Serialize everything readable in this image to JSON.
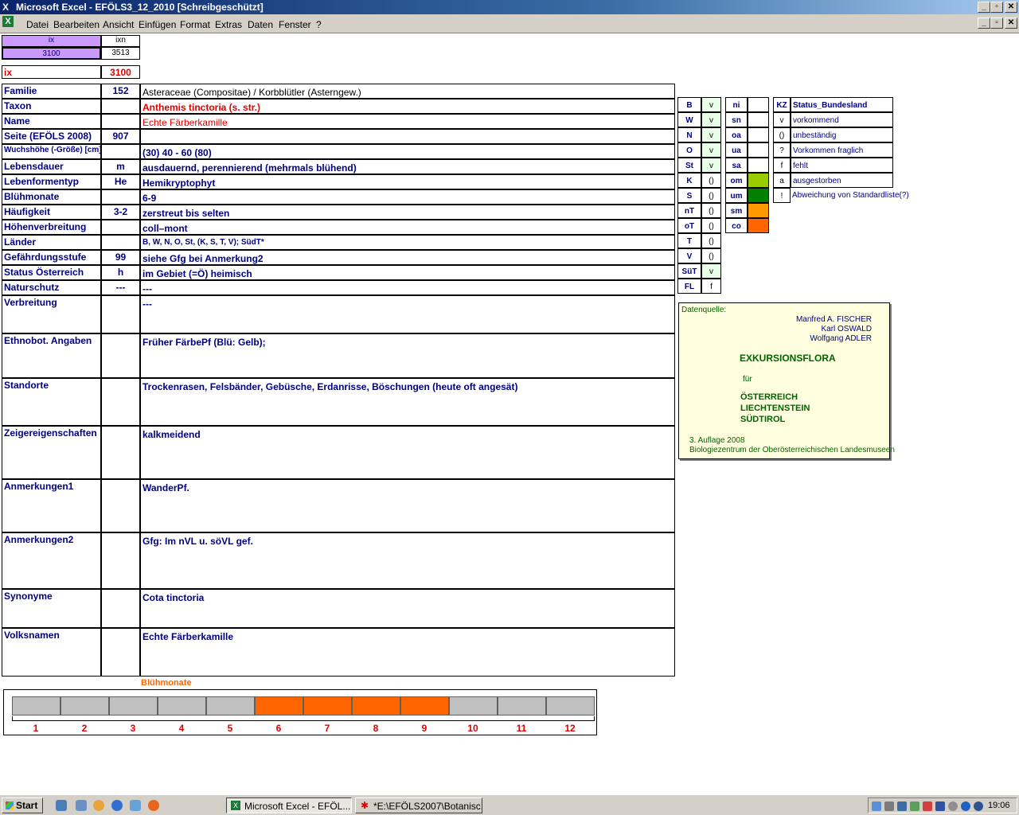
{
  "window": {
    "title": "Microsoft Excel - EFÖLS3_12_2010  [Schreibgeschützt]"
  },
  "menu": [
    "Datei",
    "Bearbeiten",
    "Ansicht",
    "Einfügen",
    "Format",
    "Extras",
    "Daten",
    "Fenster",
    "?"
  ],
  "header": {
    "ix_label": "ix",
    "ixn_label": "ixn",
    "ix_value": "3100",
    "ixn_value": "3513",
    "ix2_label": "ix",
    "ix2_value": "3100"
  },
  "rows": [
    {
      "label": "Familie",
      "code": "152",
      "text": "Asteraceae (Compositae)  /  Korbblütler (Asterngew.)"
    },
    {
      "label": "Taxon",
      "code": "",
      "text": "Anthemis tinctoria (s. str.)"
    },
    {
      "label": "Name",
      "code": "",
      "text": "Echte Färberkamille"
    },
    {
      "label": "Seite (EFÖLS 2008)",
      "code": "907",
      "text": ""
    },
    {
      "label": "Wuchshöhe (-Größe) [cm]",
      "code": "",
      "text": " (30) 40 - 60 (80)"
    },
    {
      "label": "Lebensdauer",
      "code": "m",
      "text": "ausdauernd, perennierend (mehrmals blühend)"
    },
    {
      "label": "Lebenformentyp",
      "code": "He",
      "text": "Hemikryptophyt"
    },
    {
      "label": "Blühmonate",
      "code": "",
      "text": " 6-9"
    },
    {
      "label": "Häufigkeit",
      "code": "3-2",
      "text": "zerstreut bis selten"
    },
    {
      "label": "Höhenverbreitung",
      "code": "",
      "text": "coll–mont"
    },
    {
      "label": "Länder",
      "code": "",
      "text": "B, W, N, O, St, (K, S, T, V); SüdT*"
    },
    {
      "label": "Gefährdungsstufe",
      "code": "99",
      "text": "siehe Gfg bei Anmerkung2"
    },
    {
      "label": "Status Österreich",
      "code": "h",
      "text": "im Gebiet (=Ö) heimisch"
    },
    {
      "label": "Naturschutz",
      "code": "---",
      "text": " ---"
    },
    {
      "label": "Verbreitung",
      "code": "",
      "text": " ---"
    },
    {
      "label": "Ethnobot. Angaben",
      "code": "",
      "text": "Früher FärbePf (Blü: Gelb);"
    },
    {
      "label": "Standorte",
      "code": "",
      "text": "Trockenrasen, Felsbänder, Gebüsche, Erdanrisse, Böschungen (heute oft angesät)"
    },
    {
      "label": "Zeigereigenschaften",
      "code": "",
      "text": "kalkmeidend"
    },
    {
      "label": "Anmerkungen1",
      "code": "",
      "text": "WanderPf."
    },
    {
      "label": "Anmerkungen2",
      "code": "",
      "text": "Gfg:  Im nVL u. söVL gef."
    },
    {
      "label": "Synonyme",
      "code": "",
      "text": "Cota tinctoria"
    },
    {
      "label": "Volksnamen",
      "code": "",
      "text": "Echte Färberkamille"
    }
  ],
  "states": [
    {
      "code": "B",
      "val": "v"
    },
    {
      "code": "W",
      "val": "v"
    },
    {
      "code": "N",
      "val": "v"
    },
    {
      "code": "O",
      "val": "v"
    },
    {
      "code": "St",
      "val": "v"
    },
    {
      "code": "K",
      "val": "()"
    },
    {
      "code": "S",
      "val": "()"
    },
    {
      "code": "nT",
      "val": "()"
    },
    {
      "code": "oT",
      "val": "()"
    },
    {
      "code": "T",
      "val": "()"
    },
    {
      "code": "V",
      "val": "()"
    },
    {
      "code": "SüT",
      "val": "v"
    },
    {
      "code": "FL",
      "val": "f"
    }
  ],
  "regions": [
    {
      "code": "ni",
      "color": ""
    },
    {
      "code": "sn",
      "color": ""
    },
    {
      "code": "oa",
      "color": ""
    },
    {
      "code": "ua",
      "color": ""
    },
    {
      "code": "sa",
      "color": ""
    },
    {
      "code": "om",
      "color": "#99cc00"
    },
    {
      "code": "um",
      "color": "#008000"
    },
    {
      "code": "sm",
      "color": "#ff9900"
    },
    {
      "code": "co",
      "color": "#ff6600"
    }
  ],
  "status_legend": {
    "kz": "KZ",
    "title": "Status_Bundesland",
    "items": [
      {
        "code": "v",
        "text": "vorkommend"
      },
      {
        "code": "()",
        "text": "unbeständig"
      },
      {
        "code": "?",
        "text": "Vorkommen fraglich"
      },
      {
        "code": "f",
        "text": "fehlt"
      },
      {
        "code": "a",
        "text": "ausgestorben"
      },
      {
        "code": "!",
        "text": "Abweichung von Standardliste(?)"
      }
    ]
  },
  "datasource": {
    "heading": "Datenquelle:",
    "authors": [
      "Manfred A. FISCHER",
      "Karl OSWALD",
      "Wolfgang ADLER"
    ],
    "book": "EXKURSIONSFLORA",
    "fuer": "für",
    "countries": [
      "ÖSTERREICH",
      "LIECHTENSTEIN",
      "SÜDTIROL"
    ],
    "edition": "3. Auflage 2008",
    "publisher": "Biologiezentrum der Oberösterreichischen Landesmuseen"
  },
  "bloom": {
    "title": "Blühmonate",
    "months": [
      "1",
      "2",
      "3",
      "4",
      "5",
      "6",
      "7",
      "8",
      "9",
      "10",
      "11",
      "12"
    ],
    "active": [
      false,
      false,
      false,
      false,
      false,
      true,
      true,
      true,
      true,
      false,
      false,
      false
    ],
    "active_color": "#ff6600",
    "inactive_color": "#c0c0c0"
  },
  "taskbar": {
    "start": "Start",
    "tasks": [
      "Microsoft Excel - EFÖL...",
      "*E:\\EFÖLS2007\\Botanisc..."
    ],
    "clock": "19:06"
  }
}
